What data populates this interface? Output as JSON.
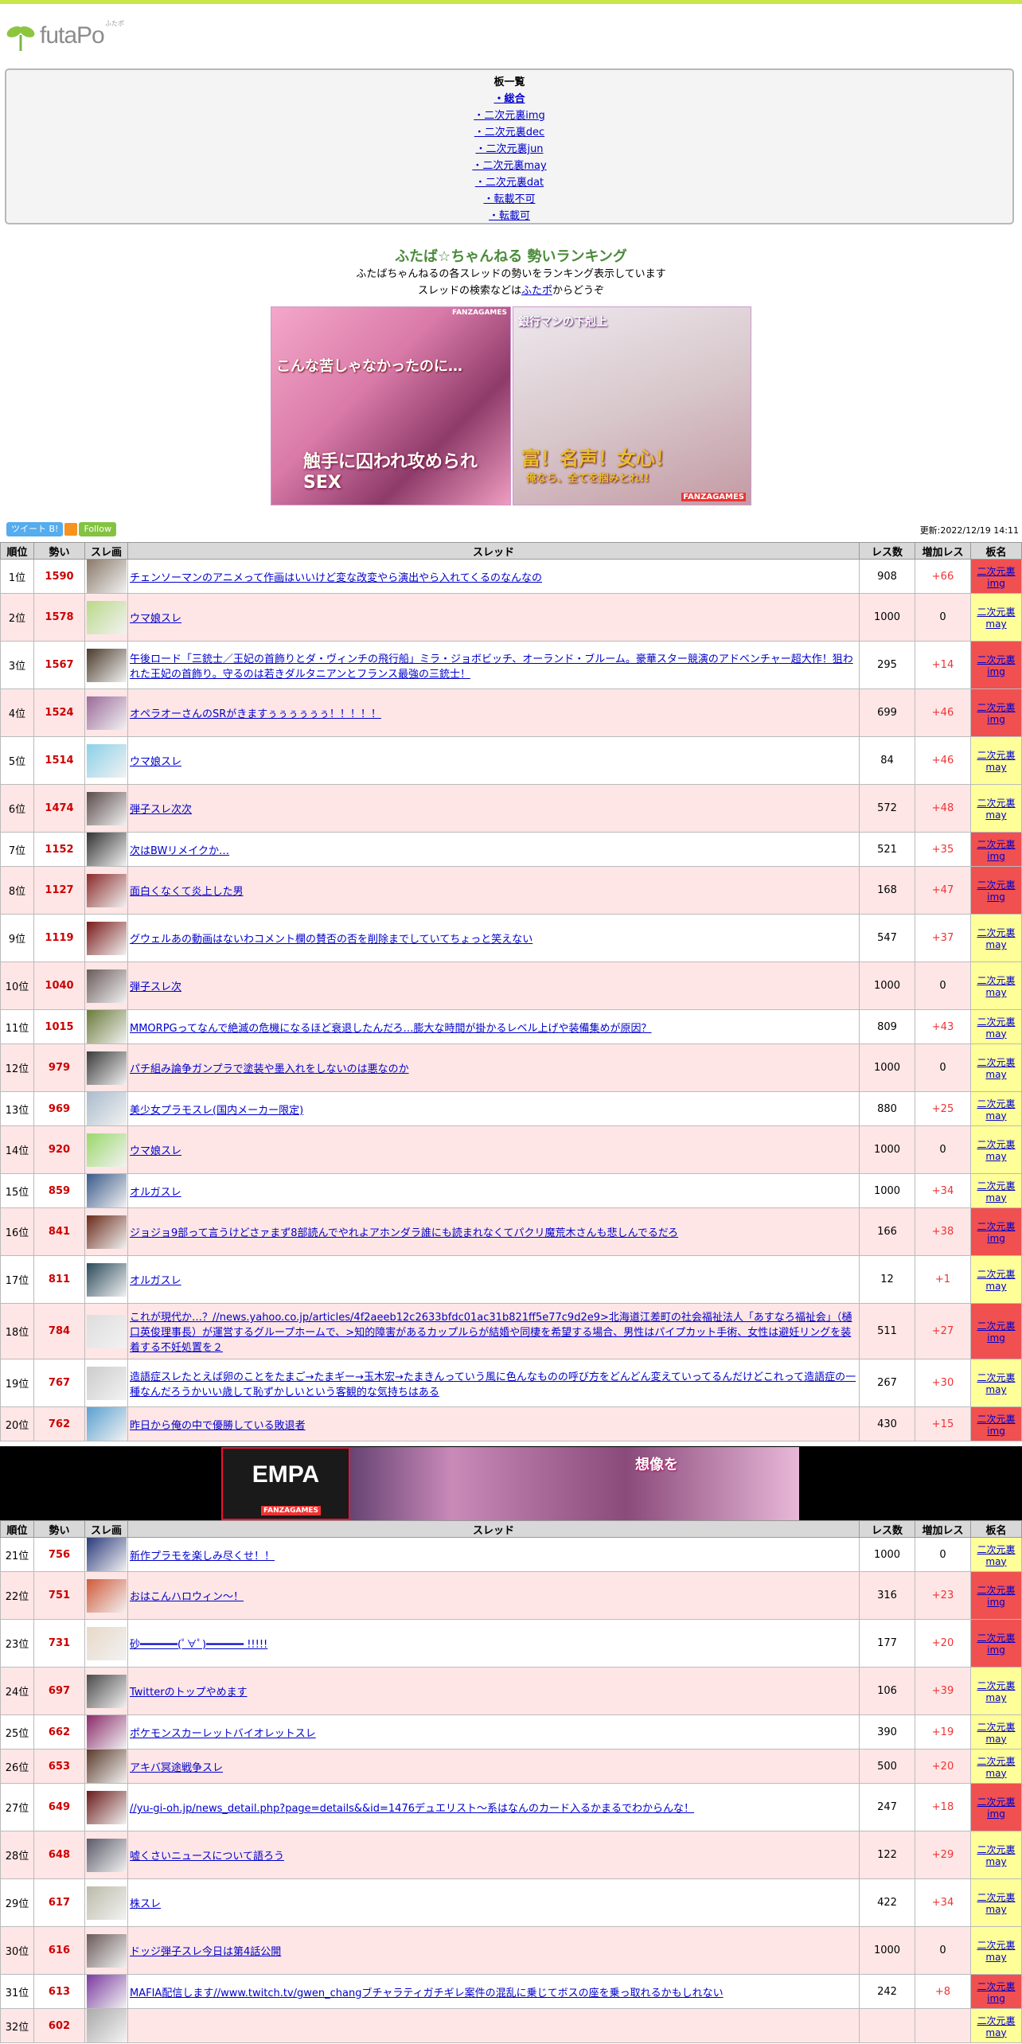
{
  "site": {
    "logo_text": "futaPo",
    "logo_ruby": "ふたポ"
  },
  "boards": {
    "heading": "板一覧",
    "items": [
      "・総合",
      "・二次元裏img",
      "・二次元裏dec",
      "・二次元裏jun",
      "・二次元裏may",
      "・二次元裏dat",
      "・転載不可",
      "・転載可"
    ]
  },
  "intro": {
    "title": "ふたば☆ちゃんねる 勢いランキング",
    "line1": "ふたばちゃんねるの各スレッドの勢いをランキング表示しています",
    "line2_prefix": "スレッドの検索などは",
    "line2_link": "ふたポ",
    "line2_suffix": "からどうぞ"
  },
  "ads": {
    "ad1_text1": "こんな苦しゃなかったのに…",
    "ad1_text2": "触手に囚われ攻められSEX",
    "ad1_brand": "FANZAGAMES",
    "ad2_text1": "銀行マンの下剋上",
    "ad2_text2": "富！名声！女心！",
    "ad2_text3": "俺なら、全てを掴みとれ!!",
    "ad2_brand": "FANZAGAMES",
    "mid_brand": "FANZAGAMES",
    "mid_text": "想像を"
  },
  "social": {
    "tweet": "ツイート",
    "follow": "Follow"
  },
  "updated": "更新:2022/12/19 14:11",
  "table": {
    "headers": {
      "rank": "順位",
      "score": "勢い",
      "thumb": "スレ画",
      "thread": "スレッド",
      "res": "レス数",
      "inc": "増加レス",
      "board": "板名"
    },
    "rows": [
      {
        "rank": "1位",
        "score": "1590",
        "title": "チェンソーマンのアニメって作画はいいけど変な改変やら演出やら入れてくるのなんなの",
        "res": "908",
        "inc": "+66",
        "board": "二次元裏img",
        "b": "img",
        "c": "#8a7a6a"
      },
      {
        "rank": "2位",
        "score": "1578",
        "title": "ウマ娘スレ",
        "res": "1000",
        "inc": "0",
        "board": "二次元裏may",
        "b": "may",
        "c": "#b9d98a"
      },
      {
        "rank": "3位",
        "score": "1567",
        "title": "午後ロード「三銃士／王妃の首飾りとダ・ヴィンチの飛行船」ミラ・ジョボビッチ、オーランド・ブルーム。豪華スター競演のアドベンチャー超大作！狙われた王妃の首飾り。守るのは若きダルタニアンとフランス最強の三銃士！",
        "res": "295",
        "inc": "+14",
        "board": "二次元裏img",
        "b": "img",
        "c": "#4a3a2a"
      },
      {
        "rank": "4位",
        "score": "1524",
        "title": "オペラオーさんのSRがきますぅぅぅぅぅぅ！！！！！",
        "res": "699",
        "inc": "+46",
        "board": "二次元裏img",
        "b": "img",
        "c": "#9a6a9a"
      },
      {
        "rank": "5位",
        "score": "1514",
        "title": "ウマ娘スレ",
        "res": "84",
        "inc": "+46",
        "board": "二次元裏may",
        "b": "may",
        "c": "#8ad0e8"
      },
      {
        "rank": "6位",
        "score": "1474",
        "title": "弾子スレ次次",
        "res": "572",
        "inc": "+48",
        "board": "二次元裏may",
        "b": "may",
        "c": "#5a4a4a"
      },
      {
        "rank": "7位",
        "score": "1152",
        "title": "次はBWリメイクか…",
        "res": "521",
        "inc": "+35",
        "board": "二次元裏img",
        "b": "img",
        "c": "#333333"
      },
      {
        "rank": "8位",
        "score": "1127",
        "title": "面白くなくて炎上した男",
        "res": "168",
        "inc": "+47",
        "board": "二次元裏img",
        "b": "img",
        "c": "#8a2a2a"
      },
      {
        "rank": "9位",
        "score": "1119",
        "title": "グウェルあの動画はないわコメント欄の賛否の否を削除までしていてちょっと笑えない",
        "res": "547",
        "inc": "+37",
        "board": "二次元裏may",
        "b": "may",
        "c": "#7a1a1a"
      },
      {
        "rank": "10位",
        "score": "1040",
        "title": "弾子スレ次",
        "res": "1000",
        "inc": "0",
        "board": "二次元裏may",
        "b": "may",
        "c": "#6a5a5a"
      },
      {
        "rank": "11位",
        "score": "1015",
        "title": "MMORPGってなんで絶滅の危機になるほど衰退したんだろ…膨大な時間が掛かるレベル上げや装備集めが原因？",
        "res": "809",
        "inc": "+43",
        "board": "二次元裏may",
        "b": "may",
        "c": "#6a7a3a"
      },
      {
        "rank": "12位",
        "score": "979",
        "title": "パチ組み論争ガンプラで塗装や墨入れをしないのは悪なのか",
        "res": "1000",
        "inc": "0",
        "board": "二次元裏may",
        "b": "may",
        "c": "#3a3a3a"
      },
      {
        "rank": "13位",
        "score": "969",
        "title": "美少女プラモスレ(国内メーカー限定)",
        "res": "880",
        "inc": "+25",
        "board": "二次元裏may",
        "b": "may",
        "c": "#aabbcc"
      },
      {
        "rank": "14位",
        "score": "920",
        "title": "ウマ娘スレ",
        "res": "1000",
        "inc": "0",
        "board": "二次元裏may",
        "b": "may",
        "c": "#9ad86a"
      },
      {
        "rank": "15位",
        "score": "859",
        "title": "オルガスレ",
        "res": "1000",
        "inc": "+34",
        "board": "二次元裏may",
        "b": "may",
        "c": "#3a5a8a"
      },
      {
        "rank": "16位",
        "score": "841",
        "title": "ジョジョ9部って言うけどさァまず8部読んでやれよアホンダラ誰にも読まれなくてパクリ魔荒木さんも悲しんでるだろ",
        "res": "166",
        "inc": "+38",
        "board": "二次元裏img",
        "b": "img",
        "c": "#6a2a1a"
      },
      {
        "rank": "17位",
        "score": "811",
        "title": "オルガスレ",
        "res": "12",
        "inc": "+1",
        "board": "二次元裏may",
        "b": "may",
        "c": "#2a4a5a"
      },
      {
        "rank": "18位",
        "score": "784",
        "title": "これが現代か…？//news.yahoo.co.jp/articles/4f2aeeb12c2633bfdc01ac31b821ff5e77c9d2e9>北海道江差町の社会福祉法人「あすなろ福祉会」（樋口英俊理事長）が運営するグループホームで、>知的障害があるカップルらが結婚や同棲を希望する場合、男性はパイプカット手術、女性は避妊リングを装着する不妊処置を２",
        "res": "511",
        "inc": "+27",
        "board": "二次元裏img",
        "b": "img",
        "c": "#dddddd"
      },
      {
        "rank": "19位",
        "score": "767",
        "title": "造語症スレたとえば卵のことをたまご→たまギー→玉木宏→たまきんっていう風に色んなものの呼び方をどんどん変えていってるんだけどこれって造語症の一種なんだろうかいい歳して恥ずかしいという客観的な気持ちはある",
        "res": "267",
        "inc": "+30",
        "board": "二次元裏may",
        "b": "may",
        "c": "#cccccc"
      },
      {
        "rank": "20位",
        "score": "762",
        "title": "昨日から俺の中で優勝している敗退者",
        "res": "430",
        "inc": "+15",
        "board": "二次元裏img",
        "b": "img",
        "c": "#5aa0d0"
      },
      {
        "rank": "21位",
        "score": "756",
        "title": "新作プラモを楽しみ尽くせ！！",
        "res": "1000",
        "inc": "0",
        "board": "二次元裏may",
        "b": "may",
        "c": "#2a3a7a"
      },
      {
        "rank": "22位",
        "score": "751",
        "title": "おはこんハロウィン～！",
        "res": "316",
        "inc": "+23",
        "board": "二次元裏img",
        "b": "img",
        "c": "#d05a3a"
      },
      {
        "rank": "23位",
        "score": "731",
        "title": "砂━━━━━━(ﾟ∀ﾟ)━━━━━━ !!!!!",
        "res": "177",
        "inc": "+20",
        "board": "二次元裏img",
        "b": "img",
        "c": "#e8d8c8"
      },
      {
        "rank": "24位",
        "score": "697",
        "title": "Twitterのトップやめます",
        "res": "106",
        "inc": "+39",
        "board": "二次元裏may",
        "b": "may",
        "c": "#4a4a4a"
      },
      {
        "rank": "25位",
        "score": "662",
        "title": "ポケモンスカーレットバイオレットスレ",
        "res": "390",
        "inc": "+19",
        "board": "二次元裏may",
        "b": "may",
        "c": "#8a2a6a"
      },
      {
        "rank": "26位",
        "score": "653",
        "title": "アキバ冥途戦争スレ",
        "res": "500",
        "inc": "+20",
        "board": "二次元裏may",
        "b": "may",
        "c": "#5a3a2a"
      },
      {
        "rank": "27位",
        "score": "649",
        "title": "//yu-gi-oh.jp/news_detail.php?page=details&&id=1476デュエリスト～系はなんのカード入るかまるでわからんな！",
        "res": "247",
        "inc": "+18",
        "board": "二次元裏img",
        "b": "img",
        "c": "#6a1a1a"
      },
      {
        "rank": "28位",
        "score": "648",
        "title": "嘘くさいニュースについて語ろう",
        "res": "122",
        "inc": "+29",
        "board": "二次元裏may",
        "b": "may",
        "c": "#5a5a6a"
      },
      {
        "rank": "29位",
        "score": "617",
        "title": "株スレ",
        "res": "422",
        "inc": "+34",
        "board": "二次元裏may",
        "b": "may",
        "c": "#bbbbaa"
      },
      {
        "rank": "30位",
        "score": "616",
        "title": "ドッジ弾子スレ今日は第4話公開",
        "res": "1000",
        "inc": "0",
        "board": "二次元裏may",
        "b": "may",
        "c": "#6a5a5a"
      },
      {
        "rank": "31位",
        "score": "613",
        "title": "MAFIA配信します//www.twitch.tv/gwen_changブチャラティガチギレ案件の混乱に乗じてボスの座を乗っ取れるかもしれない",
        "res": "242",
        "inc": "+8",
        "board": "二次元裏img",
        "b": "img",
        "c": "#7a3aa0"
      },
      {
        "rank": "32位",
        "score": "602",
        "title": "",
        "res": "",
        "inc": "",
        "board": "二次元裏may",
        "b": "may",
        "c": "#aaaaaa"
      }
    ]
  }
}
